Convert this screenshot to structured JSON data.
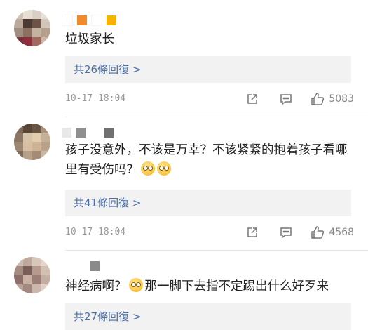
{
  "comments": [
    {
      "text": "垃圾家长",
      "replies": "共26條回復 >",
      "time": "10-17 18:04",
      "likes": "5083"
    },
    {
      "text": "孩子没意外，不该是万幸？不该紧紧的抱着孩子看哪里有受伤吗？",
      "replies": "共41條回復 >",
      "time": "10-17 18:04",
      "likes": "4568"
    },
    {
      "text_before": "神经病啊？",
      "text_after": "那一脚下去指不定踢出什么好歹来",
      "replies": "共27條回復 >"
    }
  ],
  "icons": {
    "share": "share-icon",
    "comment": "comment-icon",
    "like": "thumbs-up-icon",
    "emoji": "dizzy-face-emoji"
  },
  "colors": {
    "link": "#4a6fa5",
    "reply_bg": "#f2f2f2",
    "muted": "#999999"
  }
}
